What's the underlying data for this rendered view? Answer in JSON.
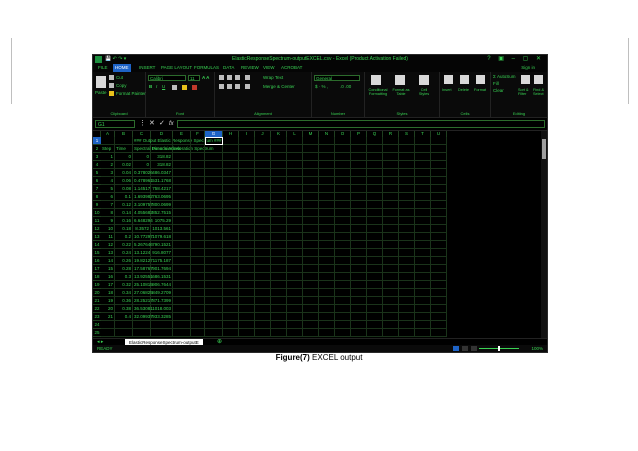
{
  "window": {
    "title": "ElasticResponseSpectrum-outputEXCEL.csv - Excel (Product Activation Failed)",
    "controls": "? ▣ – ▢ ✕"
  },
  "ribbon_tabs": [
    "FILE",
    "HOME",
    "INSERT",
    "PAGE LAYOUT",
    "FORMULAS",
    "DATA",
    "REVIEW",
    "VIEW",
    "ACROBAT"
  ],
  "active_tab": "HOME",
  "signin": "Sign in",
  "ribbon": {
    "clipboard": {
      "label": "Clipboard",
      "paste": "Paste",
      "cut": "Cut",
      "copy": "Copy",
      "format_painter": "Format Painter"
    },
    "font": {
      "label": "Font",
      "font_name": "Calibri",
      "font_size": "11"
    },
    "alignment": {
      "label": "Alignment",
      "wrap": "Wrap Text",
      "merge": "Merge & Center"
    },
    "number": {
      "label": "Number",
      "format": "General"
    },
    "styles": {
      "label": "Styles",
      "conditional": "Conditional Formatting",
      "format_table": "Format as Table",
      "cell_styles": "Cell Styles"
    },
    "cells": {
      "label": "Cells",
      "insert": "Insert",
      "delete": "Delete",
      "format": "Format"
    },
    "editing": {
      "label": "Editing",
      "autosum": "AutoSum",
      "fill": "Fill",
      "clear": "Clear",
      "sort": "Sort & Filter",
      "find": "Find & Select"
    }
  },
  "formula_bar": {
    "name_box": "G1",
    "value": ""
  },
  "columns": [
    "A",
    "B",
    "C",
    "D",
    "E",
    "F",
    "G",
    "H",
    "I",
    "J",
    "K",
    "L",
    "M",
    "N",
    "O",
    "P",
    "Q",
    "R",
    "S",
    "T",
    "U"
  ],
  "selected_column": "G",
  "rows": [
    {
      "n": "1",
      "cells": [
        "",
        "",
        "### Output Elastic Response Spectrum ###",
        "",
        "",
        "",
        ""
      ]
    },
    {
      "n": "2",
      "cells": [
        "Step",
        "Time",
        "Spectral Dimensionless",
        "Pseudo Acceleration Spectrum",
        "",
        "",
        ""
      ]
    },
    {
      "n": "3",
      "cells": [
        "1",
        "0",
        "0",
        "318.82",
        "",
        "",
        ""
      ]
    },
    {
      "n": "4",
      "cells": [
        "2",
        "0.02",
        "0",
        "318.82",
        "",
        "",
        ""
      ]
    },
    {
      "n": "5",
      "cells": [
        "3",
        "0.04",
        "0.378026",
        "486.0347",
        "",
        "",
        ""
      ]
    },
    {
      "n": "6",
      "cells": [
        "4",
        "0.06",
        "0.478961",
        "531.1768",
        "",
        "",
        ""
      ]
    },
    {
      "n": "7",
      "cells": [
        "5",
        "0.08",
        "1.14517",
        "758.4217",
        "",
        "",
        ""
      ]
    },
    {
      "n": "8",
      "cells": [
        "6",
        "0.1",
        "1.693982",
        "763.0695",
        "",
        "",
        ""
      ]
    },
    {
      "n": "9",
      "cells": [
        "7",
        "0.12",
        "3.109757",
        "800.0699",
        "",
        "",
        ""
      ]
    },
    {
      "n": "10",
      "cells": [
        "8",
        "0.14",
        "4.055682",
        "852.7515",
        "",
        "",
        ""
      ]
    },
    {
      "n": "11",
      "cells": [
        "9",
        "0.16",
        "6.648294",
        "1075.29",
        "",
        "",
        ""
      ]
    },
    {
      "n": "12",
      "cells": [
        "10",
        "0.18",
        "8.3572",
        "1013.561",
        "",
        "",
        ""
      ]
    },
    {
      "n": "13",
      "cells": [
        "11",
        "0.2",
        "10.77297",
        "1079.618",
        "",
        "",
        ""
      ]
    },
    {
      "n": "14",
      "cells": [
        "12",
        "0.22",
        "5.267646",
        "790.1521",
        "",
        "",
        ""
      ]
    },
    {
      "n": "15",
      "cells": [
        "13",
        "0.24",
        "13.1224",
        "916.8077",
        "",
        "",
        ""
      ]
    },
    {
      "n": "16",
      "cells": [
        "14",
        "0.26",
        "19.82127",
        "1175.187",
        "",
        "",
        ""
      ]
    },
    {
      "n": "17",
      "cells": [
        "15",
        "0.28",
        "17.58767",
        "901.7694",
        "",
        "",
        ""
      ]
    },
    {
      "n": "18",
      "cells": [
        "16",
        "0.3",
        "13.92551",
        "686.1531",
        "",
        "",
        ""
      ]
    },
    {
      "n": "19",
      "cells": [
        "17",
        "0.32",
        "25.10815",
        "906.7644",
        "",
        "",
        ""
      ]
    },
    {
      "n": "20",
      "cells": [
        "18",
        "0.34",
        "27.06825",
        "849.2709",
        "",
        "",
        ""
      ]
    },
    {
      "n": "21",
      "cells": [
        "19",
        "0.36",
        "28.25217",
        "871.7399",
        "",
        "",
        ""
      ]
    },
    {
      "n": "22",
      "cells": [
        "20",
        "0.38",
        "36.53081",
        "1018.003",
        "",
        "",
        ""
      ]
    },
    {
      "n": "23",
      "cells": [
        "21",
        "0.4",
        "32.09937",
        "933.3285",
        "",
        "",
        ""
      ]
    },
    {
      "n": "24",
      "cells": [
        "",
        "",
        "",
        "",
        "",
        "",
        ""
      ]
    },
    {
      "n": "25",
      "cells": [
        "",
        "",
        "",
        "",
        "",
        "",
        ""
      ]
    }
  ],
  "sheet_tab": "ElasticResponseSpectrum-outputE",
  "status": {
    "ready": "READY",
    "zoom": "100%",
    "zoom_level": 0.5
  },
  "caption": {
    "figure": "Figure(7)",
    "text": "EXCEL output"
  },
  "colors": {
    "accent": "#1e63c6",
    "text": "#39d353",
    "background": "#000000"
  }
}
